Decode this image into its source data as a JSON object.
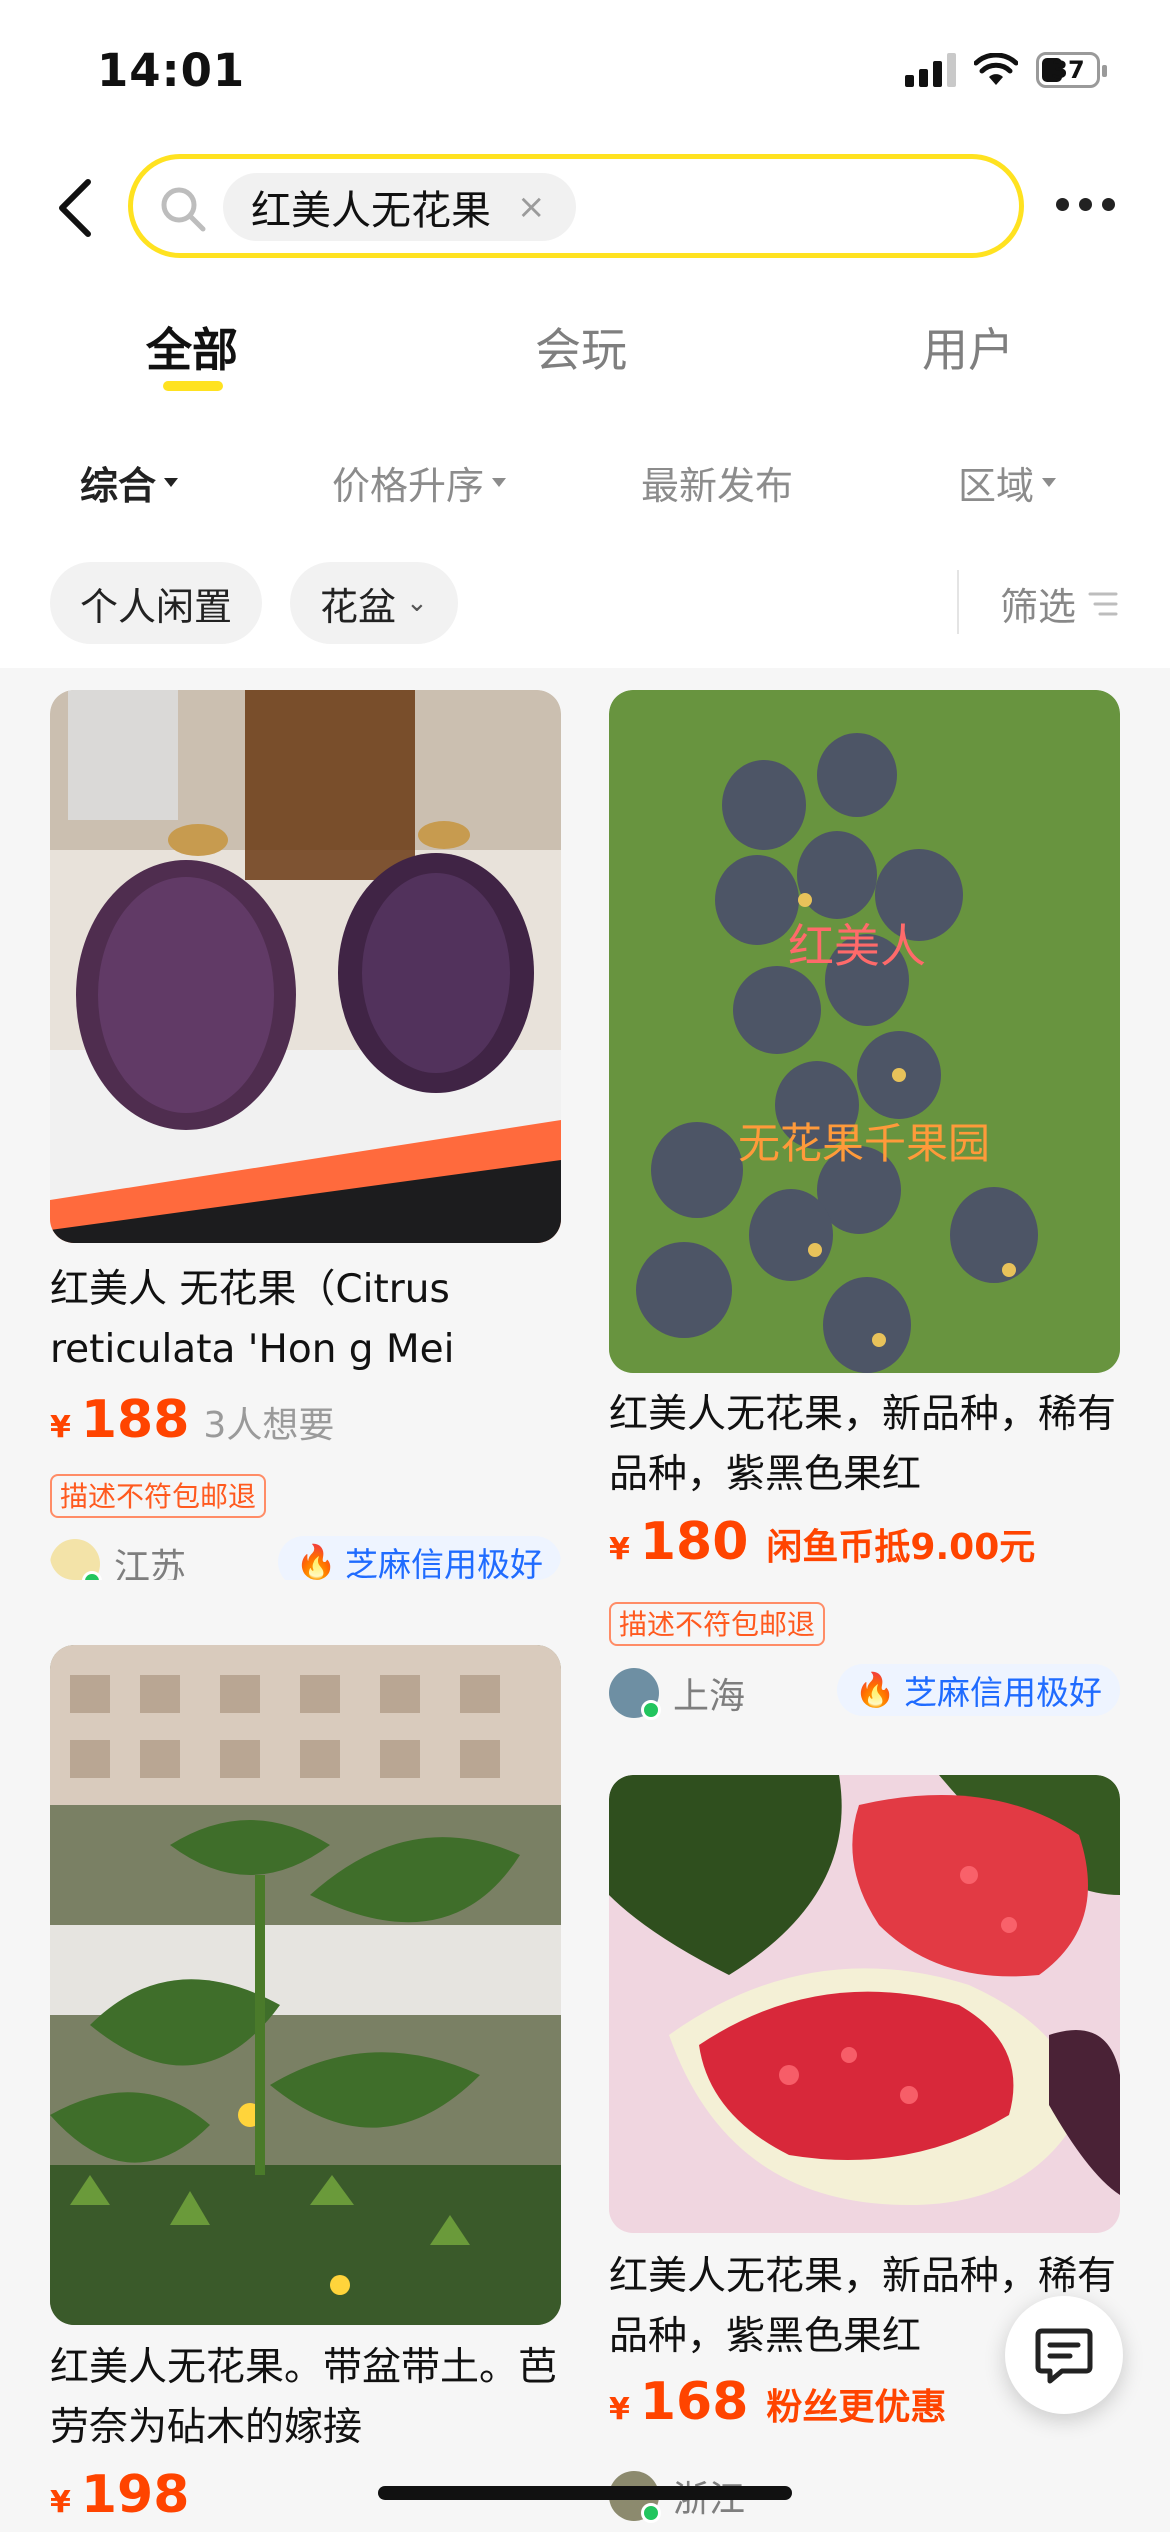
{
  "status_bar": {
    "time": "14:01",
    "battery": "37"
  },
  "search": {
    "query": "红美人无花果",
    "clear": "×"
  },
  "tabs": [
    {
      "label": "全部",
      "active": true
    },
    {
      "label": "会玩",
      "active": false
    },
    {
      "label": "用户",
      "active": false
    }
  ],
  "sort": {
    "comprehensive": "综合",
    "price_asc": "价格升序",
    "latest": "最新发布",
    "region": "区域"
  },
  "filters": {
    "chip1": "个人闲置",
    "chip2": "花盆",
    "filter": "筛选"
  },
  "colors": {
    "accent_yellow": "#ffe220",
    "price_orange": "#ff4400",
    "credit_blue": "#1f6bff"
  },
  "items": [
    {
      "title": "红美人 无花果（Citrus reticulata 'Hon g Mei",
      "price": "188",
      "want": "3人想要",
      "tag": "描述不符包邮退",
      "region": "江苏",
      "credit": "芝麻信用极好"
    },
    {
      "title": "红美人无花果，新品种，稀有品种，紫黑色果红",
      "image_text": [
        "红美人",
        "无花果千果园"
      ],
      "price": "180",
      "promo": "闲鱼币抵9.00元",
      "tag": "描述不符包邮退",
      "region": "上海",
      "credit": "芝麻信用极好"
    },
    {
      "title": "红美人无花果。带盆带土。芭劳奈为砧木的嫁接",
      "price": "198"
    },
    {
      "title": "红美人无花果，新品种，稀有品种，紫黑色果红",
      "price": "168",
      "promo": "粉丝更优惠",
      "region": "浙江"
    }
  ],
  "currency": "¥"
}
